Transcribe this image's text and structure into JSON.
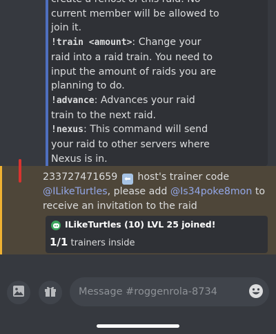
{
  "embed": {
    "line0": "create a rehost of this raid. No",
    "line1": "current member will be allowed to",
    "line2": "join it.",
    "train_cmd": "!train <amount>",
    "train_desc": ": Change your",
    "train_line2": "raid into a raid train. You need to",
    "train_line3": "input the amount of raids you are",
    "train_line4": "planning to do.",
    "advance_cmd": "!advance",
    "advance_desc": ": Advances your raid",
    "advance_line2": "train to the next raid.",
    "nexus_cmd": "!nexus",
    "nexus_desc": ": This command will send",
    "nexus_line2": "your raid to other servers where",
    "nexus_line3": "Nexus is in."
  },
  "message": {
    "code": "233727471659",
    "emoji": "⬅",
    "after_emoji": "host's trainer code",
    "mention1": "@ILikeTurtles",
    "middle": ", please add ",
    "mention2": "@Is34poke8mon",
    "end1": " to",
    "end2": "receive an invitation to the raid"
  },
  "join_embed": {
    "title": "ILikeTurtles (10) LVL 25 joined!",
    "count": "1/1",
    "count_label": " trainers inside"
  },
  "input": {
    "placeholder": "Message #roggenrola-8734"
  },
  "icons": {
    "image": "image-icon",
    "gift": "gift-icon",
    "emoji": "emoji-icon",
    "join": "discord-icon"
  },
  "colors": {
    "background": "#36393f",
    "mention_highlight": "#4e4639",
    "mention_border": "#f0b232",
    "mention_text": "#93a7e8",
    "embed_border": "#4f6fbf"
  }
}
